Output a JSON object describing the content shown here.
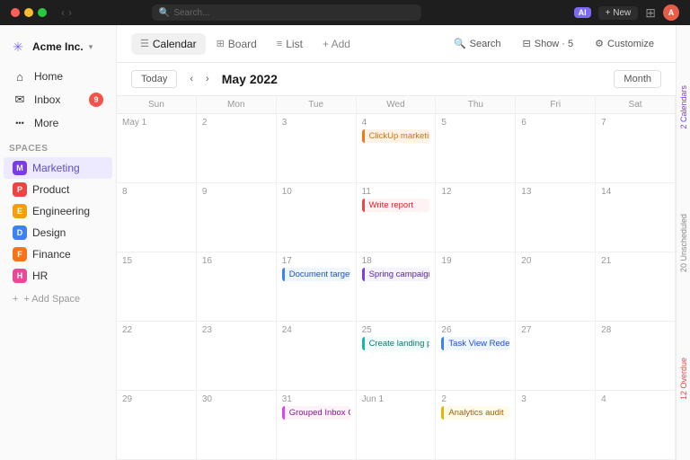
{
  "titlebar": {
    "dots": [
      "red",
      "yellow",
      "green"
    ],
    "search_placeholder": "Search...",
    "ai_label": "AI",
    "new_label": "+ New"
  },
  "sidebar": {
    "company": "Acme Inc.",
    "nav_items": [
      {
        "id": "home",
        "label": "Home",
        "icon": "⌂"
      },
      {
        "id": "inbox",
        "label": "Inbox",
        "icon": "✉",
        "badge": "9"
      },
      {
        "id": "more",
        "label": "More",
        "icon": "···"
      }
    ],
    "spaces_label": "Spaces",
    "spaces": [
      {
        "id": "marketing",
        "label": "Marketing",
        "icon": "M",
        "color": "#7c3aed",
        "active": true
      },
      {
        "id": "product",
        "label": "Product",
        "icon": "P",
        "color": "#ef4444"
      },
      {
        "id": "engineering",
        "label": "Engineering",
        "icon": "E",
        "color": "#f59e0b"
      },
      {
        "id": "design",
        "label": "Design",
        "icon": "D",
        "color": "#3b82f6"
      },
      {
        "id": "finance",
        "label": "Finance",
        "icon": "F",
        "color": "#f97316"
      },
      {
        "id": "hr",
        "label": "HR",
        "icon": "H",
        "color": "#ec4899"
      }
    ],
    "add_space_label": "+ Add Space"
  },
  "topbar": {
    "tabs": [
      {
        "id": "calendar",
        "label": "Calendar",
        "icon": "☰",
        "active": true
      },
      {
        "id": "board",
        "label": "Board",
        "icon": "⊞"
      },
      {
        "id": "list",
        "label": "List",
        "icon": "≡"
      }
    ],
    "add_label": "+ Add",
    "search_label": "Search",
    "show_label": "Show · 5",
    "customize_label": "Customize"
  },
  "calendar": {
    "today_label": "Today",
    "month_label": "Month",
    "current_month": "May 2022",
    "day_headers": [
      "Sun",
      "Mon",
      "Tue",
      "Wed",
      "Thu",
      "Fri",
      "Sat"
    ],
    "weeks": [
      {
        "days": [
          {
            "date": "May 1",
            "events": []
          },
          {
            "date": "2",
            "events": []
          },
          {
            "date": "3",
            "events": []
          },
          {
            "date": "4",
            "events": [
              {
                "label": "ClickUp marketing plan",
                "style": "event-orange"
              }
            ]
          },
          {
            "date": "5",
            "events": []
          },
          {
            "date": "6",
            "events": []
          },
          {
            "date": "7",
            "events": []
          }
        ]
      },
      {
        "days": [
          {
            "date": "8",
            "events": []
          },
          {
            "date": "9",
            "events": []
          },
          {
            "date": "10",
            "events": []
          },
          {
            "date": "11",
            "events": [
              {
                "label": "Write report",
                "style": "event-red"
              }
            ]
          },
          {
            "date": "12",
            "events": []
          },
          {
            "date": "13",
            "events": []
          },
          {
            "date": "14",
            "events": []
          }
        ]
      },
      {
        "days": [
          {
            "date": "15",
            "events": []
          },
          {
            "date": "16",
            "events": []
          },
          {
            "date": "17",
            "events": [
              {
                "label": "Document target users",
                "style": "event-blue"
              }
            ]
          },
          {
            "date": "18",
            "events": [
              {
                "label": "Spring campaign image assets",
                "style": "event-purple"
              }
            ]
          },
          {
            "date": "19",
            "events": []
          },
          {
            "date": "20",
            "events": []
          },
          {
            "date": "21",
            "events": []
          }
        ]
      },
      {
        "days": [
          {
            "date": "22",
            "events": []
          },
          {
            "date": "23",
            "events": []
          },
          {
            "date": "24",
            "events": []
          },
          {
            "date": "25",
            "events": [
              {
                "label": "Create landing page",
                "style": "event-teal"
              }
            ]
          },
          {
            "date": "26",
            "events": [
              {
                "label": "Task View Redesign",
                "style": "event-blue"
              }
            ]
          },
          {
            "date": "27",
            "events": []
          },
          {
            "date": "28",
            "events": []
          }
        ]
      },
      {
        "days": [
          {
            "date": "29",
            "events": []
          },
          {
            "date": "30",
            "events": []
          },
          {
            "date": "31",
            "events": [
              {
                "label": "Grouped Inbox Comments",
                "style": "event-pink"
              }
            ]
          },
          {
            "date": "Jun 1",
            "events": []
          },
          {
            "date": "2",
            "events": [
              {
                "label": "Analytics audit",
                "style": "event-yellow"
              }
            ]
          },
          {
            "date": "3",
            "events": []
          },
          {
            "date": "4",
            "events": []
          }
        ]
      }
    ]
  },
  "right_sidebar": {
    "calendars_label": "2 Calendars",
    "unscheduled_label": "20 Unscheduled",
    "overdue_label": "12 Overdue"
  }
}
